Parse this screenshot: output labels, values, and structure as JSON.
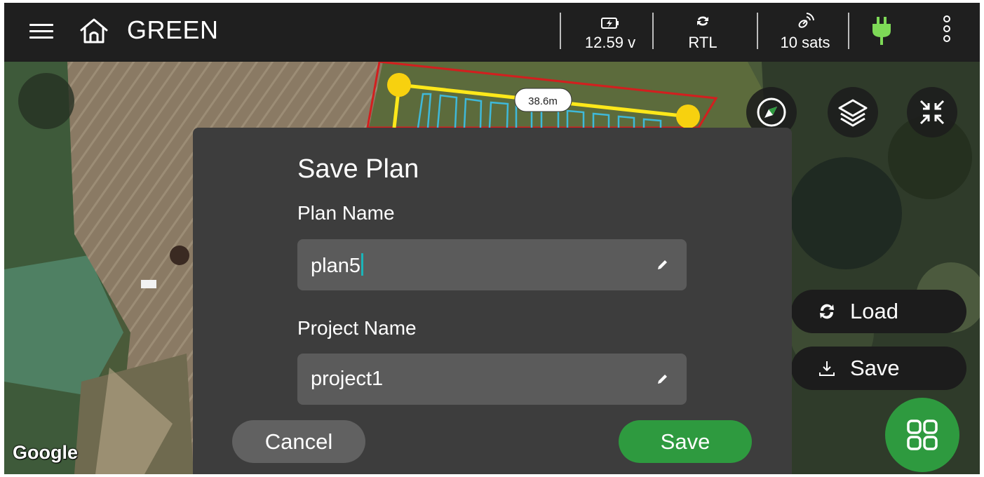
{
  "header": {
    "title": "GREEN",
    "menu_icon": "hamburger-icon",
    "home_icon": "home-icon",
    "battery": {
      "icon": "battery-charging-icon",
      "value": "12.59 v"
    },
    "mode": {
      "icon": "sync-icon",
      "value": "RTL"
    },
    "gps": {
      "icon": "satellite-icon",
      "value": "10 sats"
    },
    "power_icon": "plug-icon",
    "more_icon": "kebab-icon",
    "power_color": "#7ed957"
  },
  "map": {
    "distance_label": "38.6m",
    "attribution": "Google",
    "colors": {
      "boundary": "#d21f1f",
      "path": "#ffe81a",
      "survey": "#3fb9d9",
      "waypoint": "#f7d10f"
    }
  },
  "map_controls": {
    "compass_icon": "compass-icon",
    "layers_icon": "layers-icon",
    "collapse_icon": "collapse-icon"
  },
  "side_actions": {
    "load": {
      "icon": "refresh-icon",
      "label": "Load"
    },
    "save": {
      "icon": "download-icon",
      "label": "Save"
    },
    "grid_icon": "grid-icon"
  },
  "dialog": {
    "title": "Save Plan",
    "plan_name_label": "Plan Name",
    "plan_name_value": "plan5",
    "project_name_label": "Project Name",
    "project_name_value": "project1",
    "cancel_label": "Cancel",
    "save_label": "Save"
  },
  "colors": {
    "accent": "#2e9a3f",
    "dialog_bg": "#3d3d3d",
    "field_bg": "#5b5b5b",
    "caret": "#1bb4b8"
  }
}
